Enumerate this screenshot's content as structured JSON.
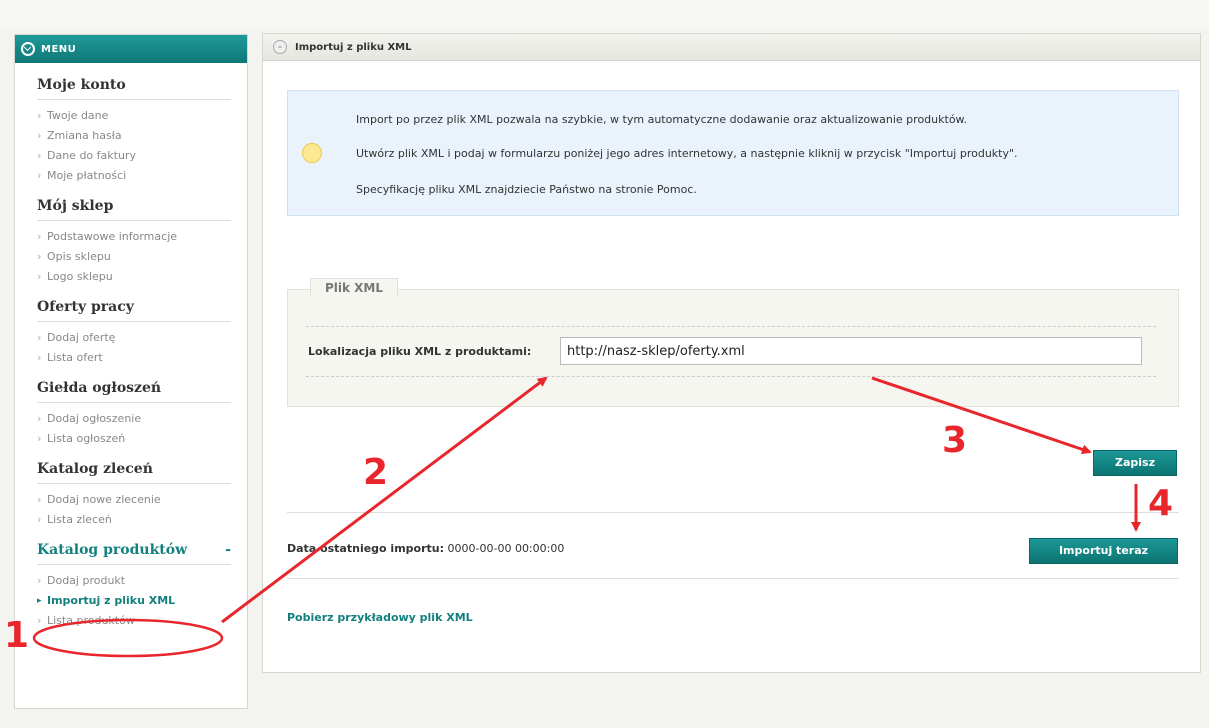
{
  "menu": {
    "title": "MENU"
  },
  "sidebar": {
    "sections": [
      {
        "title": "Moje konto",
        "items": [
          "Twoje dane",
          "Zmiana hasła",
          "Dane do faktury",
          "Moje płatności"
        ]
      },
      {
        "title": "Mój sklep",
        "items": [
          "Podstawowe informacje",
          "Opis sklepu",
          "Logo sklepu"
        ]
      },
      {
        "title": "Oferty pracy",
        "items": [
          "Dodaj ofertę",
          "Lista ofert"
        ]
      },
      {
        "title": "Giełda ogłoszeń",
        "items": [
          "Dodaj ogłoszenie",
          "Lista ogłoszeń"
        ]
      },
      {
        "title": "Katalog zleceń",
        "items": [
          "Dodaj nowe zlecenie",
          "Lista zleceń"
        ]
      },
      {
        "title": "Katalog produktów",
        "expand": "-",
        "items": [
          "Dodaj produkt",
          "Importuj z pliku XML",
          "Lista produktów"
        ],
        "active_item": "Importuj z pliku XML"
      }
    ]
  },
  "panel": {
    "title": "Importuj z pliku XML",
    "info": [
      "Import po przez plik XML pozwala na szybkie, w tym automatyczne dodawanie oraz aktualizowanie produktów.",
      "Utwórz plik XML i podaj w formularzu poniżej jego adres internetowy, a następnie kliknij w przycisk \"Importuj produkty\".",
      "Specyfikację pliku XML znajdziecie Państwo na stronie Pomoc."
    ],
    "fieldset_legend": "Plik XML",
    "field_label": "Lokalizacja pliku XML z produktami:",
    "field_value": "http://nasz-sklep/oferty.xml",
    "save_label": "Zapisz",
    "last_import_label": "Data ostatniego importu:",
    "last_import_value": "0000-00-00 00:00:00",
    "import_label": "Importuj teraz",
    "sample_link": "Pobierz przykładowy plik XML"
  },
  "annotations": {
    "n1": "1",
    "n2": "2",
    "n3": "3",
    "n4": "4"
  },
  "colors": {
    "accent": "#12807e",
    "annotation": "#e8262c"
  }
}
